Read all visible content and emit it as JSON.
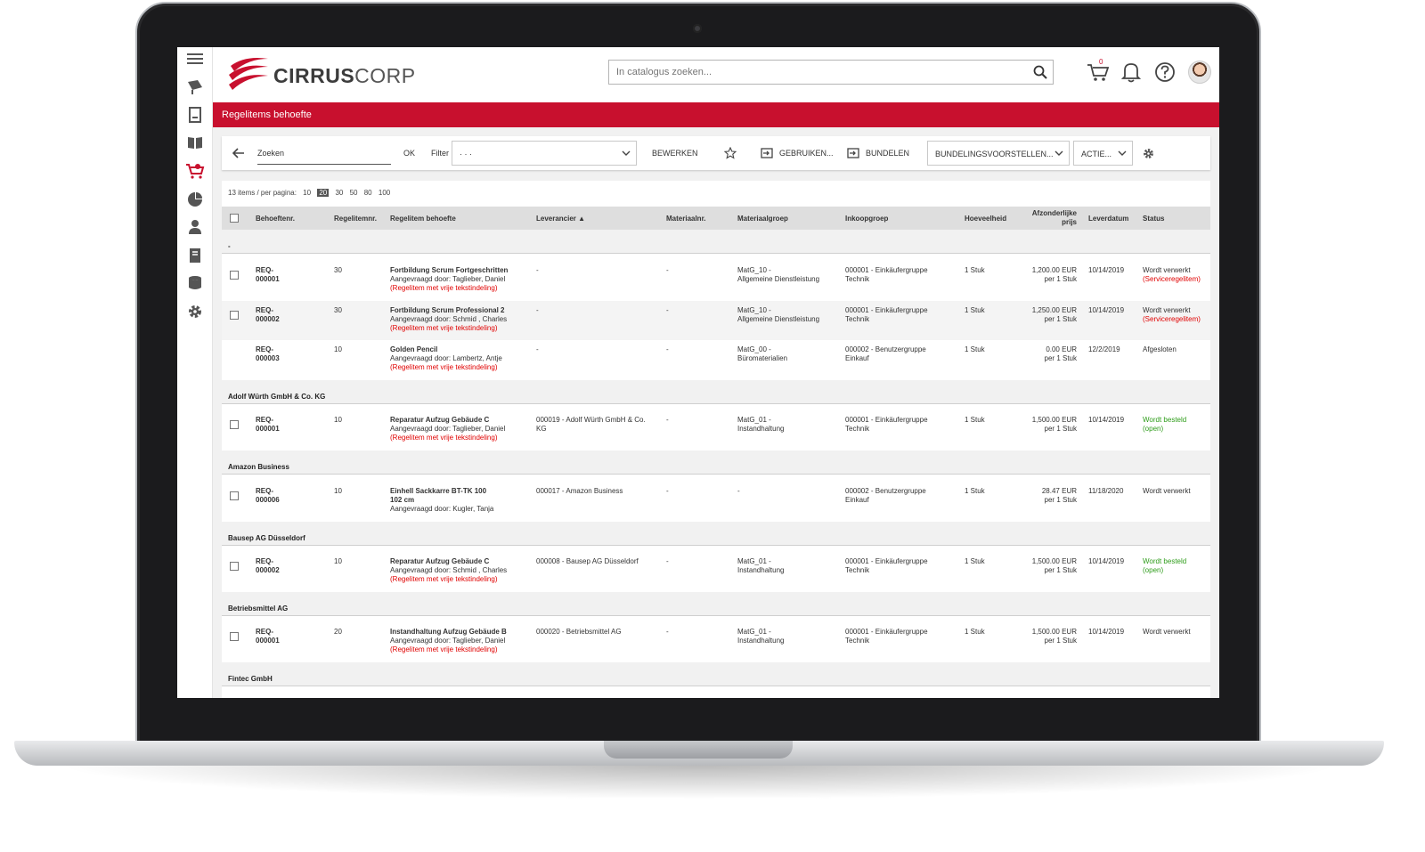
{
  "app": {
    "logo_strong": "CIRRUS",
    "logo_light": "CORP",
    "search_placeholder": "In catalogus zoeken...",
    "cart_count": "0",
    "page_title": "Regelitems behoefte",
    "colors": {
      "brand": "#c8102e",
      "status_ok": "#2d9c19",
      "alert": "#e00000"
    }
  },
  "sidebar": {
    "items": [
      {
        "icon": "menu-icon"
      },
      {
        "icon": "catalog-icon"
      },
      {
        "icon": "document-icon"
      },
      {
        "icon": "book-icon"
      },
      {
        "icon": "cart-icon"
      },
      {
        "icon": "pie-chart-icon"
      },
      {
        "icon": "user-icon"
      },
      {
        "icon": "notes-icon"
      },
      {
        "icon": "database-icon"
      },
      {
        "icon": "gear-icon"
      }
    ]
  },
  "toolbar": {
    "search_label": "Zoeken",
    "ok": "OK",
    "filter_label": "Filter",
    "filter_value": "· · ·",
    "edit": "BEWERKEN",
    "use": "GEBRUIKEN...",
    "bundle": "BUNDELEN",
    "bundle_suggestions": "BUNDELINGSVOORSTELLEN...",
    "actions": "ACTIE..."
  },
  "paging": {
    "summary": "13 items / per pagina:",
    "sizes": [
      "10",
      "20",
      "30",
      "50",
      "80",
      "100"
    ],
    "selected": "20"
  },
  "table": {
    "columns": {
      "req": "Behoeftenr.",
      "line": "Regelitemnr.",
      "item": "Regelitem behoefte",
      "supplier": "Leverancier ▲",
      "material": "Materiaalnr.",
      "matgroup": "Materiaalgroep",
      "purchgroup": "Inkoopgroep",
      "qty": "Hoeveelheid",
      "price_1": "Afzonderlijke",
      "price_2": "prijs",
      "date": "Leverdatum",
      "status": "Status"
    },
    "groups": [
      {
        "name": "-"
      },
      {
        "name": "Adolf Würth GmbH & Co. KG"
      },
      {
        "name": "Amazon Business"
      },
      {
        "name": "Bausep AG Düsseldorf"
      },
      {
        "name": "Betriebsmittel AG"
      },
      {
        "name": "Fintec GmbH"
      }
    ],
    "rows": [
      {
        "req1": "REQ-",
        "req2": "000001",
        "line": "30",
        "title": "Fortbildung Scrum Fortgeschritten",
        "title2": "",
        "requested": "Aangevraagd door: Taglieber, Daniel",
        "note": "(Regelitem met vrije tekstindeling)",
        "supplier1": "-",
        "supplier2": "",
        "material": "-",
        "mg1": "MatG_10 -",
        "mg2": "Allgemeine Dienstleistung",
        "pg1": "000001 - Einkäufergruppe",
        "pg2": "Technik",
        "qty": "1 Stuk",
        "price": "1,200.00 EUR",
        "per": "per 1 Stuk",
        "date": "10/14/2019",
        "status1": "Wordt verwerkt",
        "status2": "(Serviceregelitem)"
      },
      {
        "req1": "REQ-",
        "req2": "000002",
        "line": "30",
        "title": "Fortbildung Scrum Professional 2",
        "title2": "",
        "requested": "Aangevraagd door: Schmid , Charles",
        "note": "(Regelitem met vrije tekstindeling)",
        "supplier1": "-",
        "supplier2": "",
        "material": "-",
        "mg1": "MatG_10 -",
        "mg2": "Allgemeine Dienstleistung",
        "pg1": "000001 - Einkäufergruppe",
        "pg2": "Technik",
        "qty": "1 Stuk",
        "price": "1,250.00 EUR",
        "per": "per 1 Stuk",
        "date": "10/14/2019",
        "status1": "Wordt verwerkt",
        "status2": "(Serviceregelitem)"
      },
      {
        "req1": "REQ-",
        "req2": "000003",
        "line": "10",
        "title": "Golden Pencil",
        "title2": "",
        "requested": "Aangevraagd door: Lambertz, Antje",
        "note": "(Regelitem met vrije tekstindeling)",
        "supplier1": "-",
        "supplier2": "",
        "material": "-",
        "mg1": "MatG_00 -",
        "mg2": "Büromaterialien",
        "pg1": "000002 - Benutzergruppe",
        "pg2": "Einkauf",
        "qty": "1 Stuk",
        "price": "0.00 EUR",
        "per": "per 1 Stuk",
        "date": "12/2/2019",
        "status1": "Afgesloten",
        "status2": ""
      },
      {
        "req1": "REQ-",
        "req2": "000001",
        "line": "10",
        "title": "Reparatur Aufzug Gebäude C",
        "title2": "",
        "requested": "Aangevraagd door: Taglieber, Daniel",
        "note": "(Regelitem met vrije tekstindeling)",
        "supplier1": "000019 - Adolf Würth GmbH & Co.",
        "supplier2": "KG",
        "material": "-",
        "mg1": "MatG_01 -",
        "mg2": "Instandhaltung",
        "pg1": "000001 - Einkäufergruppe",
        "pg2": "Technik",
        "qty": "1 Stuk",
        "price": "1,500.00 EUR",
        "per": "per 1 Stuk",
        "date": "10/14/2019",
        "status1": "Wordt besteld",
        "status2": "(open)"
      },
      {
        "req1": "REQ-",
        "req2": "000006",
        "line": "10",
        "title": "Einhell Sackkarre BT-TK 100",
        "title2": "102 cm",
        "requested": "Aangevraagd door: Kugler, Tanja",
        "note": "",
        "supplier1": "000017 - Amazon Business",
        "supplier2": "",
        "material": "-",
        "mg1": "-",
        "mg2": "",
        "pg1": "000002 - Benutzergruppe",
        "pg2": "Einkauf",
        "qty": "1 Stuk",
        "price": "28.47 EUR",
        "per": "per 1 Stuk",
        "date": "11/18/2020",
        "status1": "Wordt verwerkt",
        "status2": ""
      },
      {
        "req1": "REQ-",
        "req2": "000002",
        "line": "10",
        "title": "Reparatur Aufzug Gebäude C",
        "title2": "",
        "requested": "Aangevraagd door: Schmid , Charles",
        "note": "(Regelitem met vrije tekstindeling)",
        "supplier1": "000008 - Bausep AG Düsseldorf",
        "supplier2": "",
        "material": "-",
        "mg1": "MatG_01 -",
        "mg2": "Instandhaltung",
        "pg1": "000001 - Einkäufergruppe",
        "pg2": "Technik",
        "qty": "1 Stuk",
        "price": "1,500.00 EUR",
        "per": "per 1 Stuk",
        "date": "10/14/2019",
        "status1": "Wordt besteld",
        "status2": "(open)"
      },
      {
        "req1": "REQ-",
        "req2": "000001",
        "line": "20",
        "title": "Instandhaltung Aufzug Gebäude B",
        "title2": "",
        "requested": "Aangevraagd door: Taglieber, Daniel",
        "note": "(Regelitem met vrije tekstindeling)",
        "supplier1": "000020 - Betriebsmittel AG",
        "supplier2": "",
        "material": "-",
        "mg1": "MatG_01 -",
        "mg2": "Instandhaltung",
        "pg1": "000001 - Einkäufergruppe",
        "pg2": "Technik",
        "qty": "1 Stuk",
        "price": "1,500.00 EUR",
        "per": "per 1 Stuk",
        "date": "10/14/2019",
        "status1": "Wordt verwerkt",
        "status2": ""
      }
    ]
  }
}
